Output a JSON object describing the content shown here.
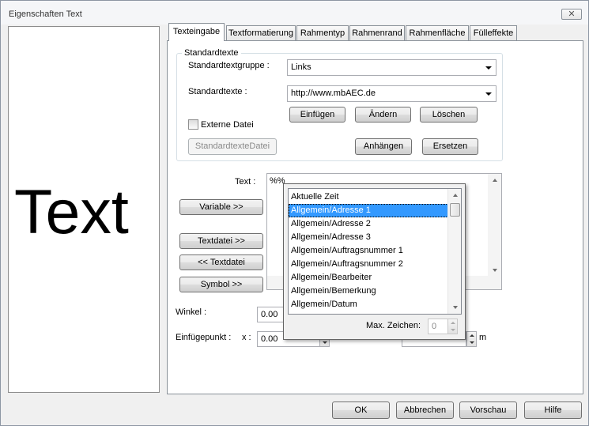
{
  "window": {
    "title": "Eigenschaften Text",
    "close_glyph": "✕"
  },
  "preview": {
    "text": "Text"
  },
  "tabs": [
    {
      "label": "Texteingabe",
      "active": true
    },
    {
      "label": "Textformatierung"
    },
    {
      "label": "Rahmentyp"
    },
    {
      "label": "Rahmenrand"
    },
    {
      "label": "Rahmenfläche"
    },
    {
      "label": "Fülleffekte"
    }
  ],
  "standardtexte": {
    "group_title": "Standardtexte",
    "gruppe_label": "Standardtextgruppe :",
    "gruppe_value": "Links",
    "texte_label": "Standardtexte :",
    "texte_value": "http://www.mbAEC.de",
    "einfuegen": "Einfügen",
    "aendern": "Ändern",
    "loeschen": "Löschen",
    "externe_datei_label": "Externe Datei",
    "externe_datei_checked": false,
    "datei_button": "StandardtexteDatei",
    "anhaengen": "Anhängen",
    "ersetzen": "Ersetzen"
  },
  "text_section": {
    "text_label": "Text :",
    "text_value": "%%",
    "variable_button": "Variable >>",
    "textdatei_button": "Textdatei >>",
    "back_textdatei_button": "<< Textdatei",
    "symbol_button": "Symbol >>"
  },
  "winkel": {
    "label": "Winkel :",
    "value": "0.00"
  },
  "einfuegepunkt": {
    "label": "Einfügepunkt :",
    "x_label": "x :",
    "x_value": "0.00",
    "unit": "m"
  },
  "variable_popup": {
    "items": [
      "Aktuelle Zeit",
      "Allgemein/Adresse 1",
      "Allgemein/Adresse 2",
      "Allgemein/Adresse 3",
      "Allgemein/Auftragsnummer 1",
      "Allgemein/Auftragsnummer 2",
      "Allgemein/Bearbeiter",
      "Allgemein/Bemerkung",
      "Allgemein/Datum"
    ],
    "selected_index": 1,
    "max_zeichen_label": "Max. Zeichen:",
    "max_zeichen_value": "0"
  },
  "footer": {
    "ok": "OK",
    "abbrechen": "Abbrechen",
    "vorschau": "Vorschau",
    "hilfe": "Hilfe"
  }
}
